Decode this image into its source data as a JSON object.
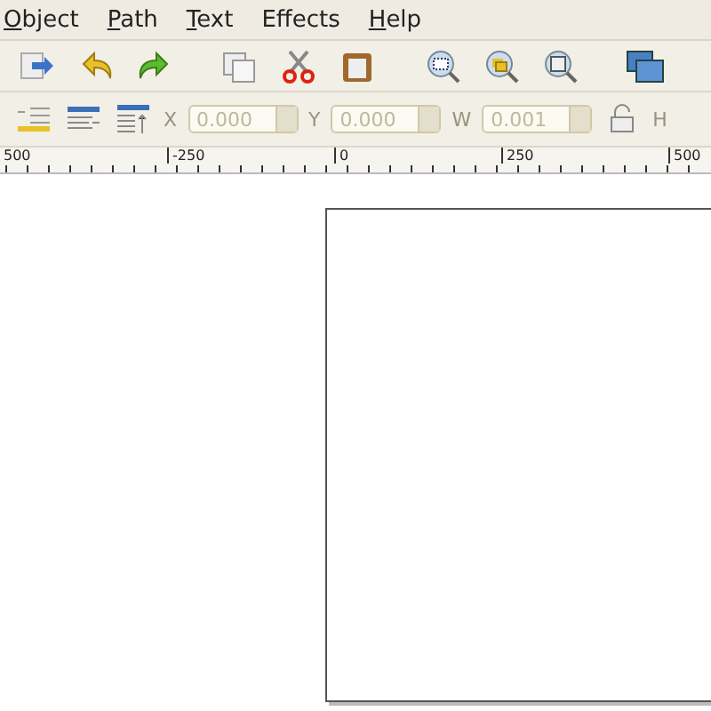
{
  "menu": [
    {
      "label": "Object",
      "mnemonic": true
    },
    {
      "label": "Path",
      "mnemonic": true
    },
    {
      "label": "Text",
      "mnemonic": true
    },
    {
      "label": "Effects",
      "mnemonic": false
    },
    {
      "label": "Help",
      "mnemonic": true
    }
  ],
  "toolbar": [
    {
      "kind": "import"
    },
    {
      "kind": "undo"
    },
    {
      "kind": "redo"
    },
    {
      "kind": "gap"
    },
    {
      "kind": "copy"
    },
    {
      "kind": "cut"
    },
    {
      "kind": "paste"
    },
    {
      "kind": "gap"
    },
    {
      "kind": "zoom-selection"
    },
    {
      "kind": "zoom-drawing"
    },
    {
      "kind": "zoom-page"
    },
    {
      "kind": "gap"
    },
    {
      "kind": "duplicate"
    }
  ],
  "tool_controls": {
    "disabled": true,
    "fields": [
      {
        "label": "X",
        "value": "0.000"
      },
      {
        "label": "Y",
        "value": "0.000"
      },
      {
        "label": "W",
        "value": "0.001"
      }
    ],
    "trailing_label": "H"
  },
  "ruler": {
    "labels": [
      {
        "text": "500"
      },
      {
        "text": "-250"
      },
      {
        "text": "0"
      },
      {
        "text": "250"
      },
      {
        "text": "500"
      }
    ]
  }
}
